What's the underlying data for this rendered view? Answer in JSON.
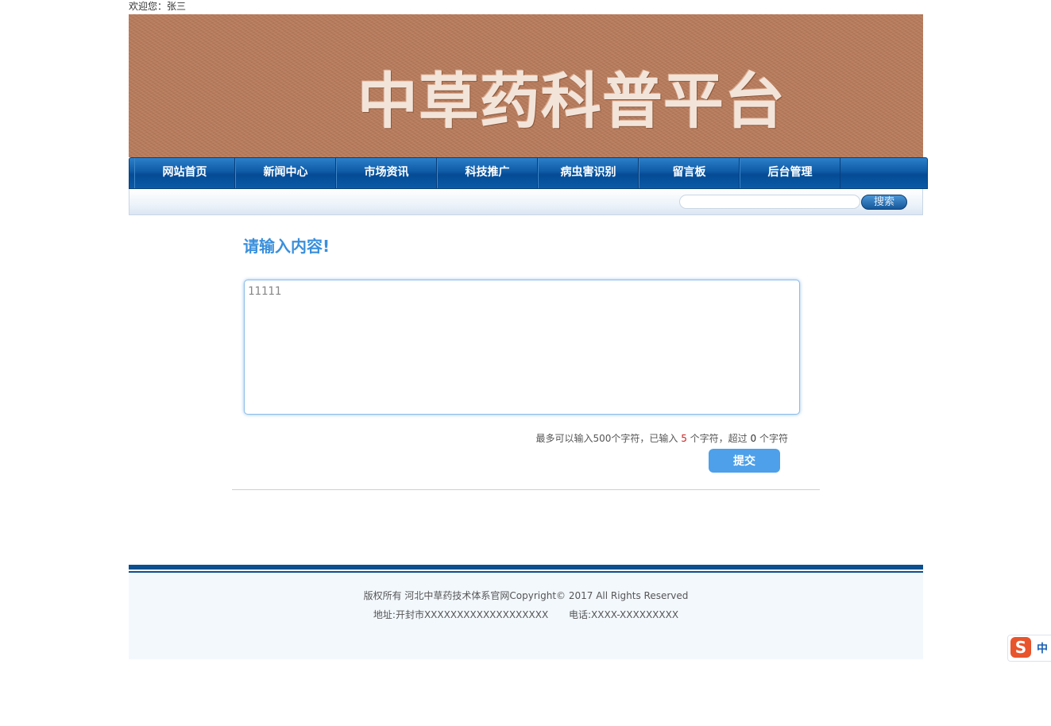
{
  "header": {
    "welcome": "欢迎您：张三",
    "banner_title": "中草药科普平台"
  },
  "nav": {
    "items": [
      {
        "label": "网站首页"
      },
      {
        "label": "新闻中心"
      },
      {
        "label": "市场资讯"
      },
      {
        "label": "科技推广"
      },
      {
        "label": "病虫害识别"
      },
      {
        "label": "留言板"
      },
      {
        "label": "后台管理"
      }
    ]
  },
  "search": {
    "value": "",
    "button_label": "搜索"
  },
  "message": {
    "prompt": "请输入内容!",
    "text": "11111",
    "counter_prefix": "最多可以输入500个字符，已输入",
    "entered_count": "5",
    "counter_middle": "个字符，超过",
    "exceed_count": "0",
    "counter_suffix": "个字符",
    "submit_label": "提交"
  },
  "footer": {
    "copyright": "版权所有 河北中草药技术体系官网Copyright© 2017 All Rights Reserved",
    "address": "地址:开封市XXXXXXXXXXXXXXXXXXX",
    "phone": "电话:XXXX-XXXXXXXXX"
  },
  "ime": {
    "logo": "S",
    "mode": "中"
  },
  "colors": {
    "nav_blue": "#0e5aa6",
    "accent": "#4da0e9",
    "banner": "#b87a5a"
  }
}
